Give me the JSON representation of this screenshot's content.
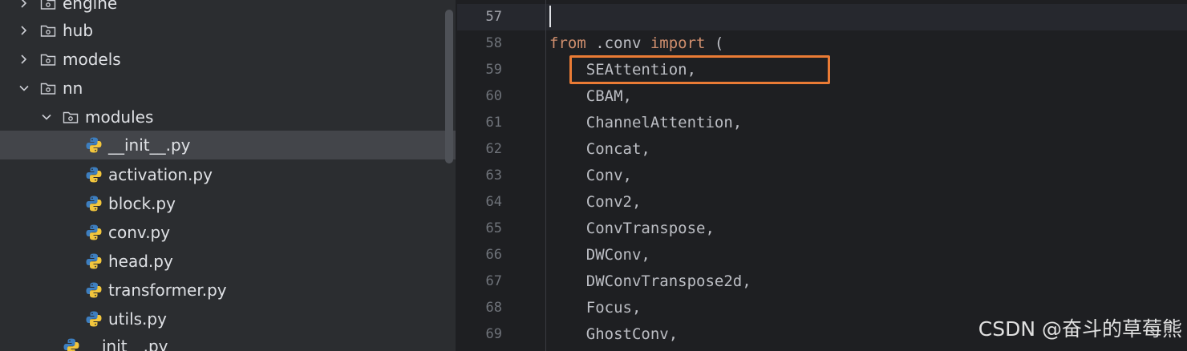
{
  "project_tree": {
    "items": [
      {
        "label": "engine",
        "type": "package",
        "expanded": false
      },
      {
        "label": "hub",
        "type": "package",
        "expanded": false
      },
      {
        "label": "models",
        "type": "package",
        "expanded": false
      },
      {
        "label": "nn",
        "type": "package",
        "expanded": true
      },
      {
        "label": "modules",
        "type": "package",
        "expanded": true
      },
      {
        "label": "__init__.py",
        "type": "python-file",
        "selected": true
      },
      {
        "label": "activation.py",
        "type": "python-file"
      },
      {
        "label": "block.py",
        "type": "python-file"
      },
      {
        "label": "conv.py",
        "type": "python-file"
      },
      {
        "label": "head.py",
        "type": "python-file"
      },
      {
        "label": "transformer.py",
        "type": "python-file"
      },
      {
        "label": "utils.py",
        "type": "python-file"
      },
      {
        "label": "__init__.py",
        "type": "python-file"
      }
    ]
  },
  "editor": {
    "lines": [
      {
        "number": "57",
        "code": ""
      },
      {
        "number": "58",
        "kw1": "from",
        "mid": " .conv ",
        "kw2": "import",
        "rest": " ("
      },
      {
        "number": "59",
        "code": "    SEAttention,"
      },
      {
        "number": "60",
        "code": "    CBAM,"
      },
      {
        "number": "61",
        "code": "    ChannelAttention,"
      },
      {
        "number": "62",
        "code": "    Concat,"
      },
      {
        "number": "63",
        "code": "    Conv,"
      },
      {
        "number": "64",
        "code": "    Conv2,"
      },
      {
        "number": "65",
        "code": "    ConvTranspose,"
      },
      {
        "number": "66",
        "code": "    DWConv,"
      },
      {
        "number": "67",
        "code": "    DWConvTranspose2d,"
      },
      {
        "number": "68",
        "code": "    Focus,"
      },
      {
        "number": "69",
        "code": "    GhostConv,"
      }
    ],
    "highlight_color": "#ea7b35"
  },
  "watermark": "CSDN @奋斗的草莓熊",
  "colors": {
    "keyword": "#cf8e6d",
    "text": "#bcbec4",
    "sidebar_bg": "#2b2d30",
    "editor_bg": "#1e1f22",
    "selection": "#43454a"
  }
}
